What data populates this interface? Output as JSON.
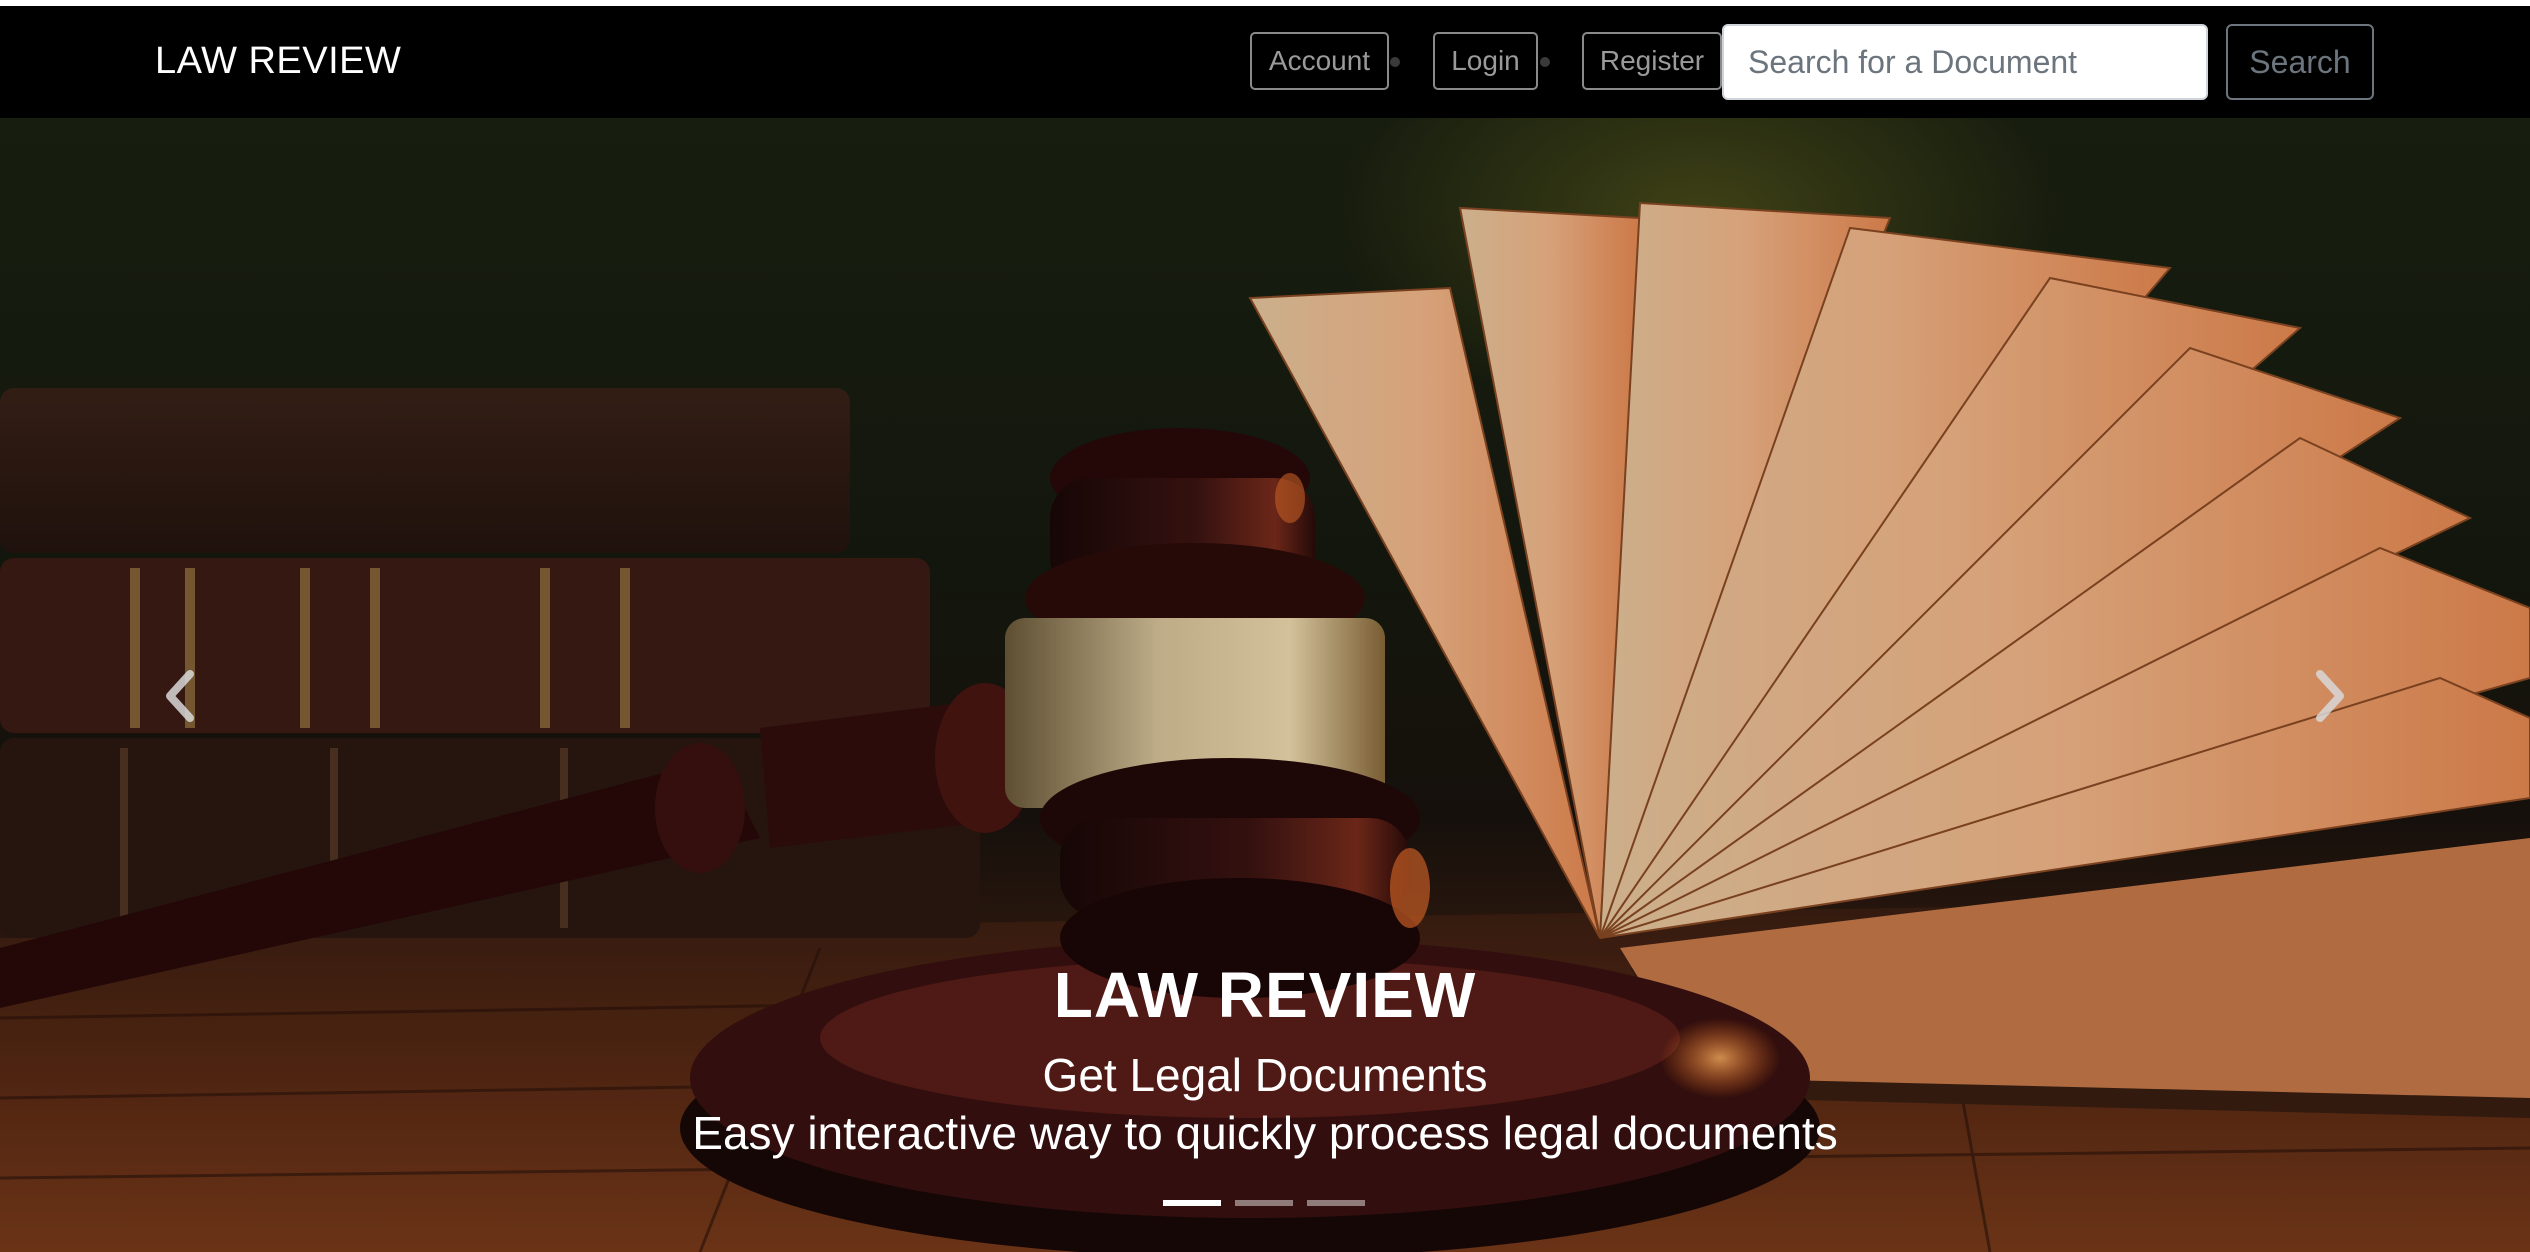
{
  "navbar": {
    "brand": "LAW REVIEW",
    "items": [
      {
        "label": "Account"
      },
      {
        "label": "Login"
      },
      {
        "label": "Register"
      }
    ],
    "search": {
      "placeholder": "Search for a Document",
      "button_label": "Search"
    }
  },
  "carousel": {
    "caption": {
      "title": "LAW REVIEW",
      "subtitle": "Get Legal Documents",
      "description": "Easy interactive way to quickly process legal documents"
    },
    "prev_icon": "chevron-left-icon",
    "next_icon": "chevron-right-icon",
    "slide_count": 3,
    "active_slide": 1
  },
  "colors": {
    "navbar_bg": "#000000",
    "nav_text": "#9a9a9a",
    "caption_text": "#ffffff"
  }
}
